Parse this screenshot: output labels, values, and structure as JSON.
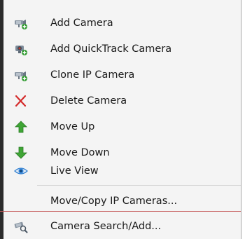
{
  "menu": {
    "items": [
      {
        "label": "Add Camera",
        "icon": "camera-add-icon"
      },
      {
        "label": "Add QuickTrack Camera",
        "icon": "quicktrack-camera-icon"
      },
      {
        "label": "Clone IP Camera",
        "icon": "camera-clone-icon"
      },
      {
        "label": "Delete Camera",
        "icon": "red-x-delete-icon"
      },
      {
        "label": "Move Up",
        "icon": "green-arrow-up-icon"
      },
      {
        "label": "Move Down",
        "icon": "green-arrow-down-icon"
      },
      {
        "label": "Live View",
        "icon": "eye-icon"
      },
      {
        "label": "Move/Copy IP Cameras...",
        "icon": ""
      },
      {
        "label": "Camera Search/Add...",
        "icon": "camera-search-icon"
      }
    ]
  },
  "colors": {
    "delete_red": "#d42a2a",
    "arrow_green": "#3fa535",
    "eye_blue": "#2f7fd1",
    "camera_gray": "#7b8794",
    "add_green": "#2e9a2e"
  }
}
